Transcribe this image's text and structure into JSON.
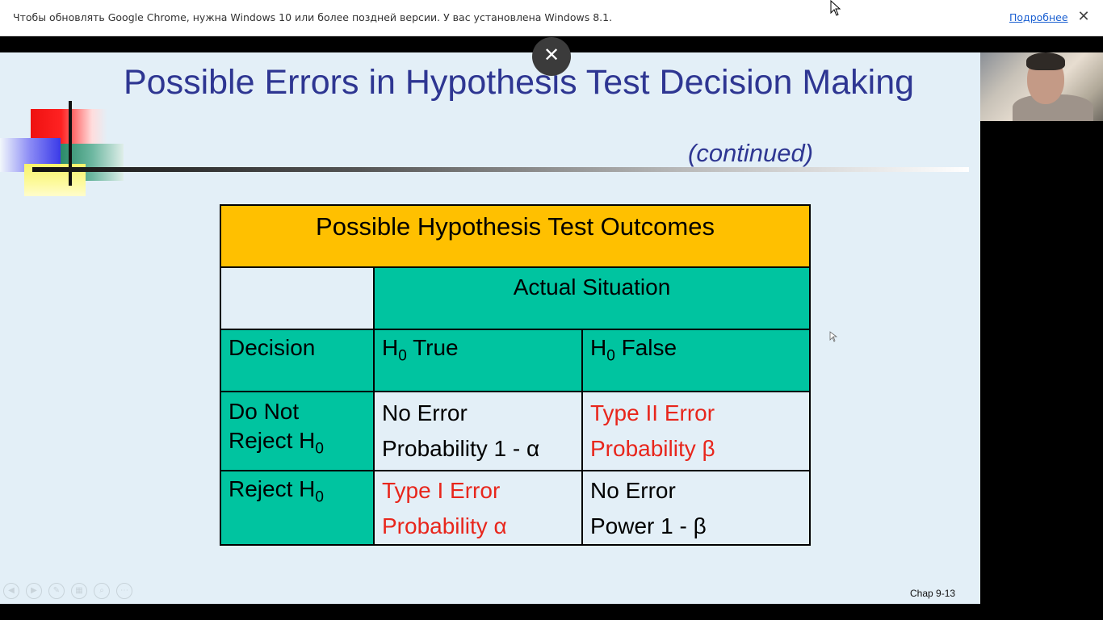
{
  "infobar": {
    "message": "Чтобы обновлять Google Chrome, нужна Windows 10 или более поздней версии. У вас установлена Windows 8.1.",
    "link": "Подробнее",
    "close": "✕"
  },
  "slide": {
    "title": "Possible Errors in Hypothesis Test Decision Making",
    "continued": "(continued)",
    "table": {
      "header": "Possible Hypothesis Test Outcomes",
      "actual_situation": "Actual Situation",
      "decision": "Decision",
      "h0_true": "H",
      "h0_false": "H",
      "sub0": "0",
      "true_word": " True",
      "false_word": " False",
      "row1_label_a": "Do Not",
      "row1_label_b": "Reject H",
      "row1_true_a": "No Error",
      "row1_true_b": "Probability 1 - α",
      "row1_false_a": "Type II Error",
      "row1_false_b": "Probability β",
      "row2_label": "Reject H",
      "row2_true_a": "Type I Error",
      "row2_true_b": "Probability α",
      "row2_false_a": "No Error",
      "row2_false_b": "Power 1 - β"
    },
    "footer": "Chap 9-13",
    "close_button": "✕"
  },
  "colors": {
    "title": "#2e3692",
    "header_fill": "#ffc000",
    "teal_fill": "#00c4a0",
    "error_text": "#e8261c"
  },
  "icons": [
    "close-icon",
    "mouse-cursor-icon",
    "prev-slide-icon",
    "next-slide-icon",
    "pen-icon",
    "slides-icon",
    "zoom-icon",
    "more-icon"
  ]
}
